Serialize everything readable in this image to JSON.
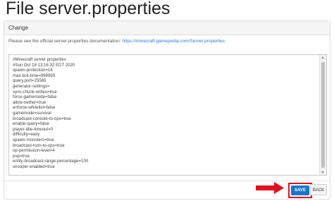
{
  "page": {
    "title": "File server.properties"
  },
  "panel": {
    "header": "Change",
    "description": "Please see the official server.properties documentation:",
    "doc_link": "https://minecraft.gamepedia.com/Server.properties"
  },
  "editor": {
    "lines": [
      "#Minecraft server properties",
      "#Sun Oct 18 13:16:32 EDT 2020",
      "spawn-protection=16",
      "max-tick-time=999999",
      "query.port=25565",
      "generator-settings=",
      "sync-chunk-writes=true",
      "force-gamemode=false",
      "allow-nether=true",
      "enforce-whitelist=false",
      "gamemode=survival",
      "broadcast-console-to-ops=true",
      "enable-query=false",
      "player-idle-timeout=0",
      "difficulty=easy",
      "spawn-monsters=true",
      "broadcast-rcon-to-ops=true",
      "op-permission-level=4",
      "pvp=true",
      "entity-broadcast-range-percentage=100",
      "snooper-enabled=true"
    ],
    "highlighted_line": "pvp=true"
  },
  "actions": {
    "save_label": "SAVE",
    "back_label": "BACK"
  },
  "colors": {
    "highlight_red": "#e3101a",
    "save_blue": "#1777d0",
    "link_blue": "#2a7ae2"
  }
}
